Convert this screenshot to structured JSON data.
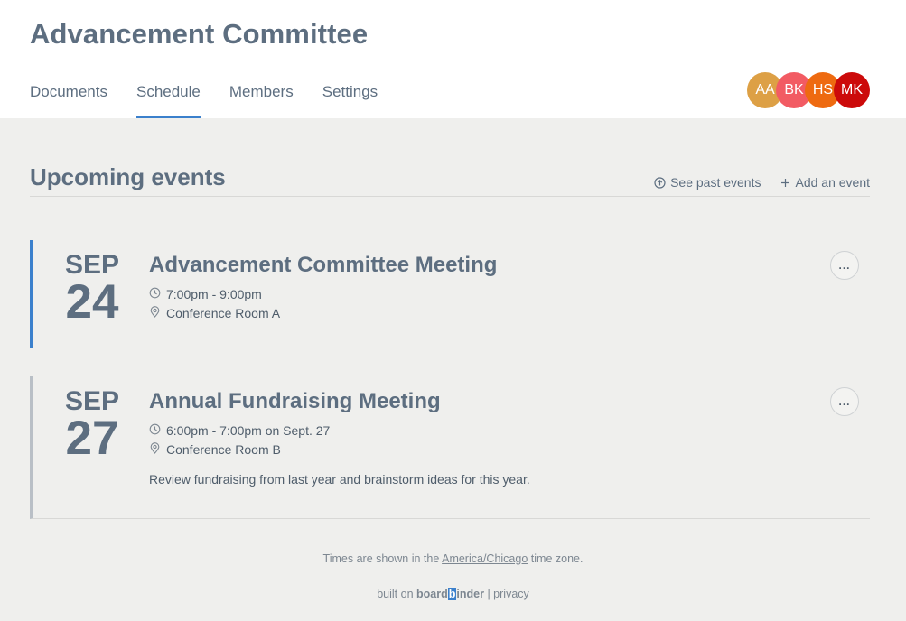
{
  "committee": {
    "title": "Advancement Committee"
  },
  "tabs": [
    {
      "label": "Documents",
      "active": false
    },
    {
      "label": "Schedule",
      "active": true
    },
    {
      "label": "Members",
      "active": false
    },
    {
      "label": "Settings",
      "active": false
    }
  ],
  "members": [
    {
      "initials": "AA",
      "color": "#dda045"
    },
    {
      "initials": "BK",
      "color": "#f25b63"
    },
    {
      "initials": "HS",
      "color": "#ee6a10"
    },
    {
      "initials": "MK",
      "color": "#cc0a0a"
    }
  ],
  "section": {
    "title": "Upcoming events",
    "past_label": "See past events",
    "add_label": "Add an event"
  },
  "events": [
    {
      "month": "SEP",
      "day": "24",
      "title": "Advancement Committee Meeting",
      "time": "7:00pm - 9:00pm",
      "location": "Conference Room A",
      "description": "",
      "more": "..."
    },
    {
      "month": "SEP",
      "day": "27",
      "title": "Annual Fundraising Meeting",
      "time": "6:00pm - 7:00pm on Sept. 27",
      "location": "Conference Room B",
      "description": "Review fundraising from last year and brainstorm ideas for this year.",
      "more": "..."
    }
  ],
  "footer": {
    "tz_prefix": "Times are shown in the",
    "tz_link": "America/Chicago",
    "tz_suffix": "time zone.",
    "built_on": "built on",
    "brand_a": "board",
    "brand_b": "b",
    "brand_c": "inder",
    "separator": "|",
    "privacy": "privacy"
  },
  "colors": {
    "accent": "#3b80cc",
    "inactive_bar": "#b9bfc6",
    "text": "#5d6e80",
    "background": "#efefed"
  }
}
